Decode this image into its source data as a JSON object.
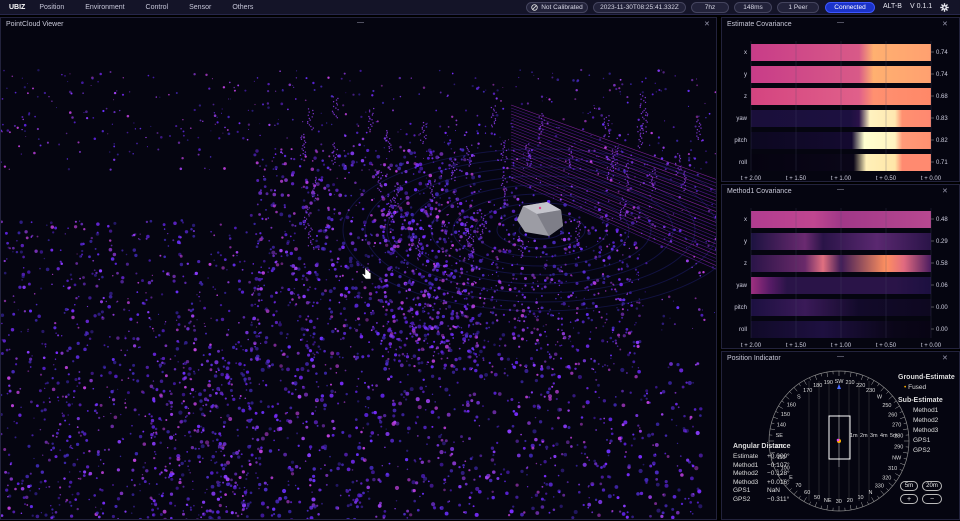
{
  "topbar": {
    "brand": "UBIZ",
    "menu": [
      "Position",
      "Environment",
      "Control",
      "Sensor",
      "Others"
    ],
    "calibration": "Not Calibrated",
    "timestamp": "2023-11-30T08:25:41.332Z",
    "rate": "7hz",
    "latency": "148ms",
    "peers": "1 Peer",
    "connection": "Connected",
    "device": "ALT-B",
    "version": "V 0.1.1"
  },
  "pointcloud": {
    "title": "PointCloud Viewer"
  },
  "estimate_cov": {
    "title": "Estimate Covariance",
    "rows": [
      "x",
      "y",
      "z",
      "yaw",
      "pitch",
      "roll"
    ],
    "values": [
      "0.74",
      "0.74",
      "0.68",
      "0.83",
      "0.82",
      "0.71"
    ],
    "xticks": [
      "t + 2.00",
      "t + 1.50",
      "t + 1.00",
      "t + 0.50",
      "t + 0.00"
    ]
  },
  "method1_cov": {
    "title": "Method1 Covariance",
    "rows": [
      "x",
      "y",
      "z",
      "yaw",
      "pitch",
      "roll"
    ],
    "values": [
      "0.48",
      "0.29",
      "0.58",
      "0.06",
      "0.00",
      "0.00"
    ],
    "xticks": [
      "t + 2.00",
      "t + 1.50",
      "t + 1.00",
      "t + 0.50",
      "t + 0.00"
    ]
  },
  "position": {
    "title": "Position Indicator",
    "compass": [
      "SW",
      "210",
      "220",
      "230",
      "W",
      "250",
      "260",
      "270",
      "280",
      "290",
      "NW",
      "310",
      "320",
      "330",
      "N",
      "10",
      "20",
      "30",
      "NE",
      "50",
      "60",
      "70",
      "E",
      "100",
      "110",
      "120",
      "SE",
      "140",
      "150",
      "160",
      "S",
      "170",
      "180",
      "190"
    ],
    "scale": [
      "1m",
      "2m",
      "3m",
      "4m",
      "5m"
    ],
    "ground_title": "Ground-Estimate",
    "ground_items": [
      "Fused"
    ],
    "sub_title": "Sub-Estimate",
    "sub_items": [
      "Method1",
      "Method2",
      "Method3",
      "GPS1",
      "GPS2"
    ],
    "angular_title": "Angular Distance",
    "angular": [
      {
        "name": "Estimate",
        "value": "+0.000°"
      },
      {
        "name": "Method1",
        "value": "−0.107°"
      },
      {
        "name": "Method2",
        "value": "−0.128°"
      },
      {
        "name": "Method3",
        "value": "+0.016°"
      },
      {
        "name": "GPS1",
        "value": "NaN"
      },
      {
        "name": "GPS2",
        "value": "−0.311°"
      }
    ],
    "btn_5m": "5m",
    "btn_20m": "20m",
    "btn_plus": "+",
    "btn_minus": "−"
  },
  "colors": {
    "accent": "#1b33c9",
    "panel_border": "#22223c",
    "point_purple": "#7a2cff"
  }
}
